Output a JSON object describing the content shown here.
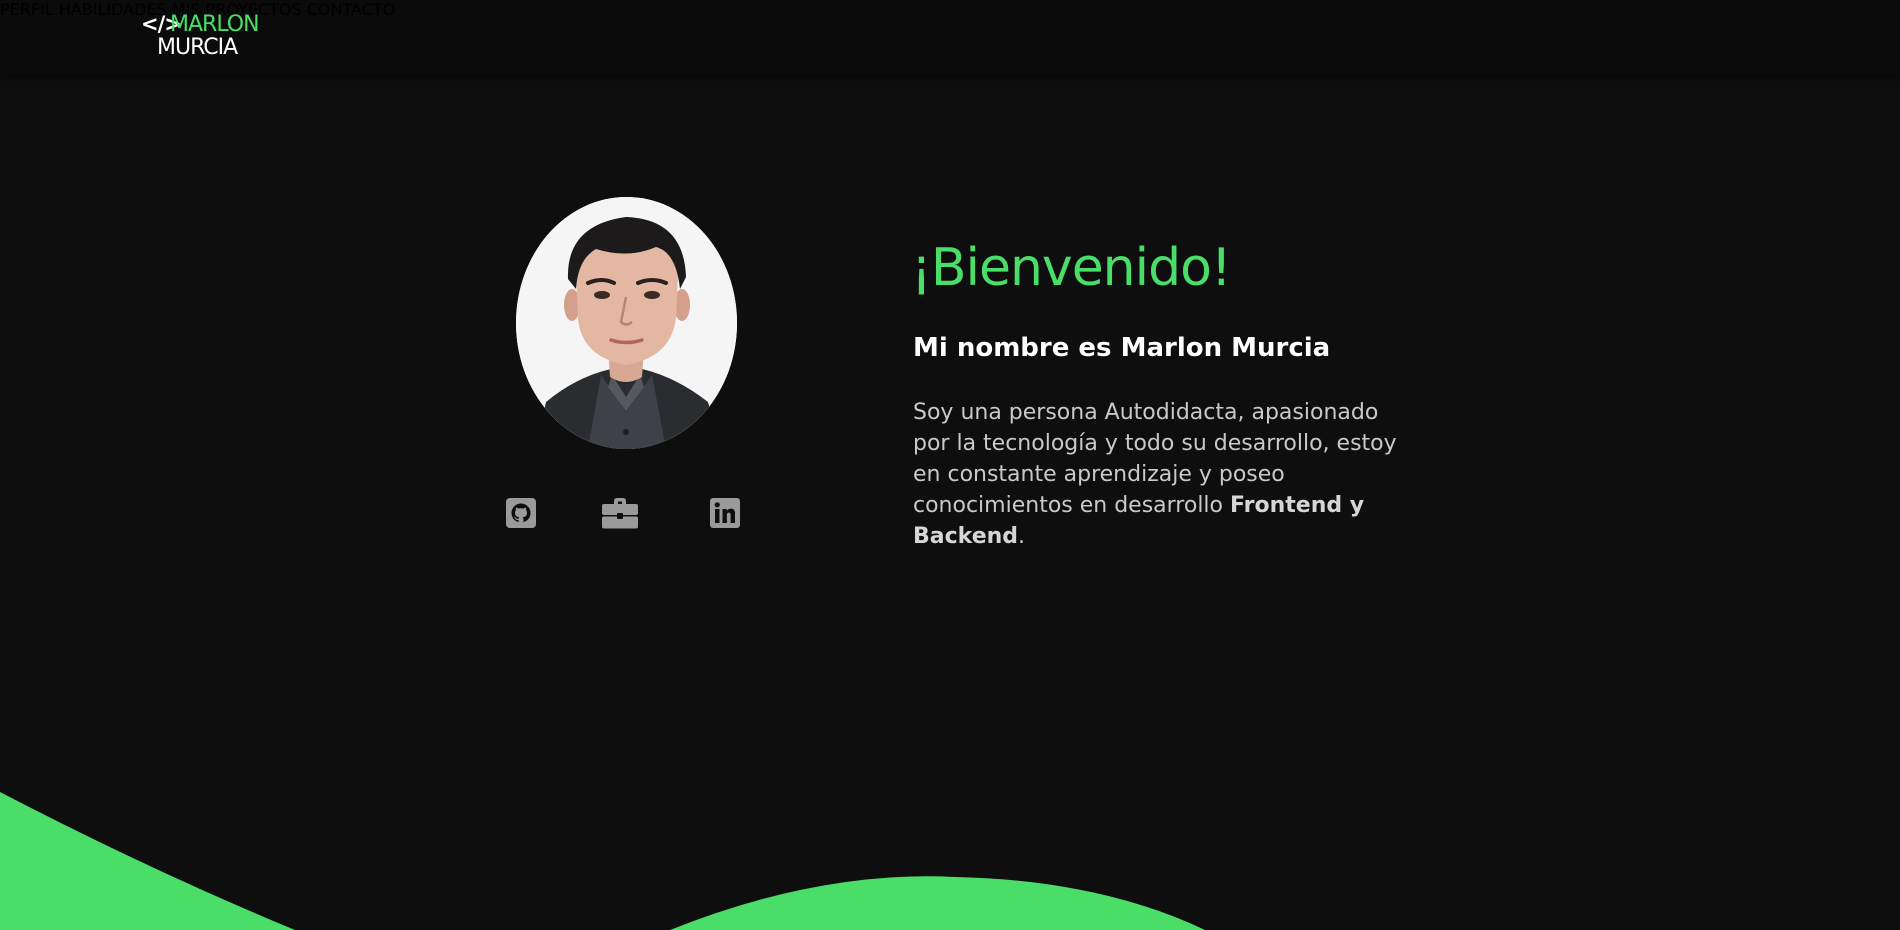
{
  "header": {
    "logo": {
      "code": "</>",
      "first": "MARLON",
      "last": "MURCIA"
    },
    "nav": [
      {
        "label": "PERFIL"
      },
      {
        "label": "HABILIDADES"
      },
      {
        "label": "MIS PROYECTOS"
      },
      {
        "label": "CONTACTO"
      }
    ]
  },
  "profile": {
    "social": [
      {
        "icon": "github-icon"
      },
      {
        "icon": "briefcase-icon"
      },
      {
        "icon": "linkedin-icon"
      }
    ]
  },
  "intro": {
    "welcome": "¡Bienvenido!",
    "name": "Mi nombre es Marlon Murcia",
    "bio_text": "Soy una persona Autodidacta, apasionado por la tecnología y todo su desarrollo, estoy en constante aprendizaje y poseo conocimientos en desarrollo ",
    "bio_strong": "Frontend y Backend",
    "bio_end": "."
  },
  "colors": {
    "background": "#0e0e0f",
    "accent": "#4ade68",
    "icon": "#9a9a9a"
  }
}
